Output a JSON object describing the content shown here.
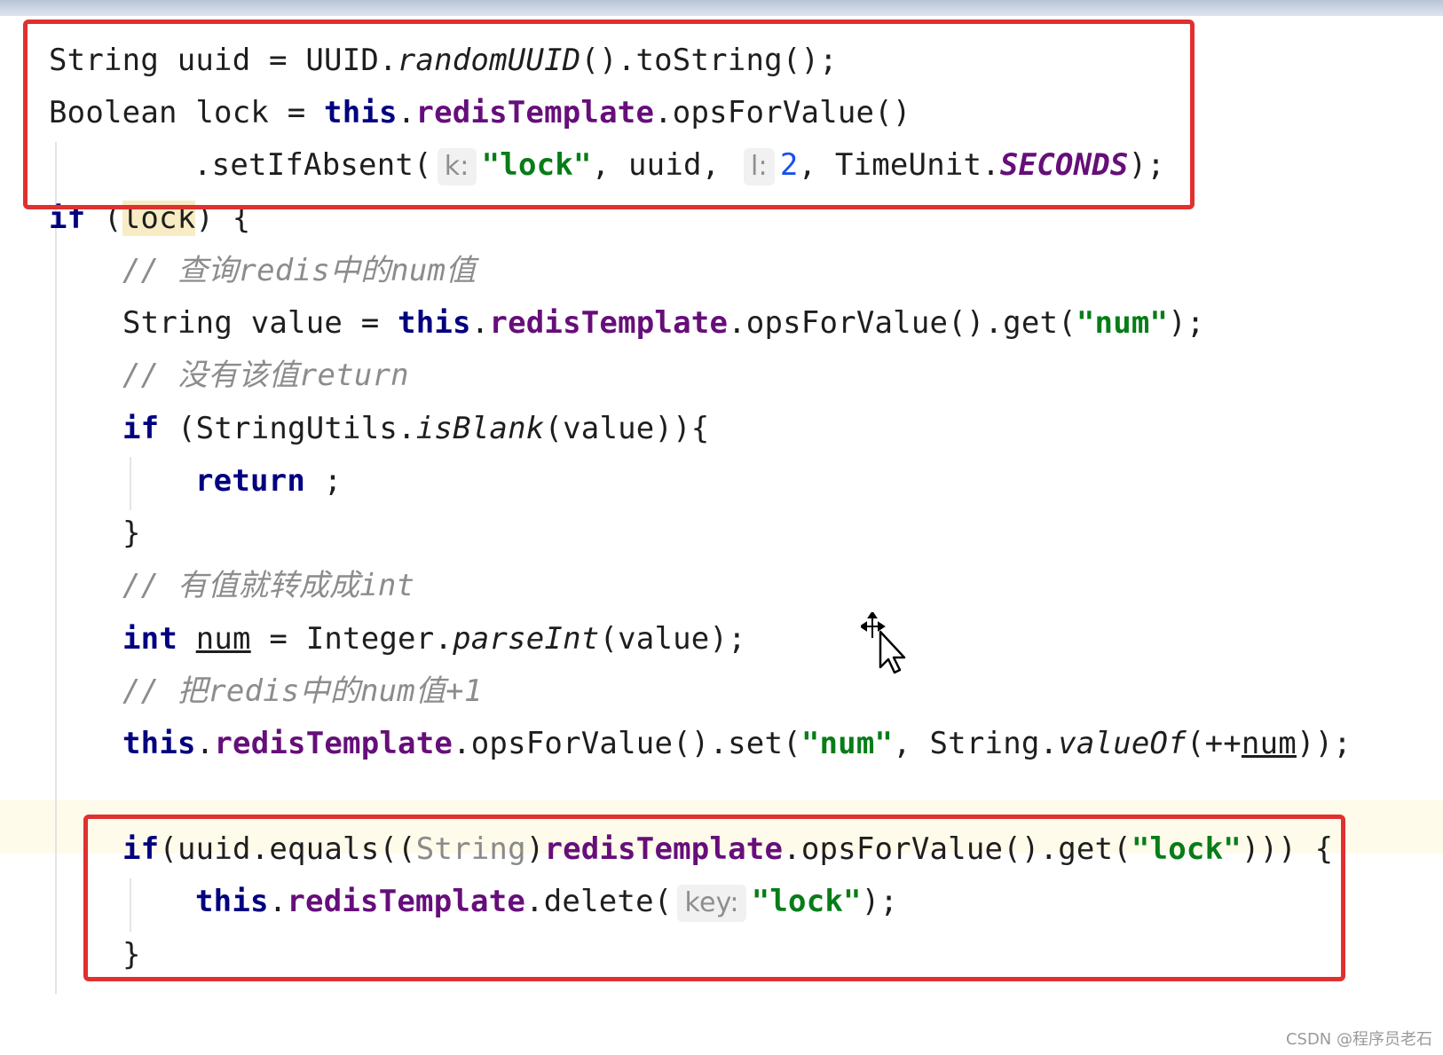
{
  "code": {
    "l1": {
      "a": "String uuid = UUID.",
      "b": "randomUUID",
      "c": "().toString();"
    },
    "l2": {
      "a": "Boolean lock = ",
      "this": "this",
      "dot": ".",
      "field": "redisTemplate",
      "c": ".opsForValue()"
    },
    "l3": {
      "a": ".setIfAbsent(",
      "hint_k": "k:",
      "str": "\"lock\"",
      "b": ", uuid, ",
      "hint_l": "l:",
      "num": "2",
      "c": ", TimeUnit.",
      "const": "SECONDS",
      "d": ");"
    },
    "l4": {
      "kw": "if",
      "a": " (",
      "lock": "lock",
      "b": ") {"
    },
    "l5": {
      "comment": "// 查询redis中的num值"
    },
    "l6": {
      "a": "String value = ",
      "this": "this",
      "dot": ".",
      "field": "redisTemplate",
      "b": ".opsForValue().get(",
      "str": "\"num\"",
      "c": ");"
    },
    "l7": {
      "comment": "// 没有该值return"
    },
    "l8": {
      "kw": "if",
      "a": " (StringUtils.",
      "ital": "isBlank",
      "b": "(value)){"
    },
    "l9": {
      "kw": "return",
      "a": " ;"
    },
    "l10": {
      "a": "}"
    },
    "l11": {
      "comment": "// 有值就转成成int"
    },
    "l12": {
      "kw": "int",
      "sp": " ",
      "var": "num",
      "a": " = Integer.",
      "ital": "parseInt",
      "b": "(value);"
    },
    "l13": {
      "comment": "// 把redis中的num值+1"
    },
    "l14": {
      "this": "this",
      "dot": ".",
      "field": "redisTemplate",
      "a": ".opsForValue().set(",
      "str": "\"num\"",
      "b": ", String.",
      "ital": "valueOf",
      "c": "(++",
      "var": "num",
      "d": "));"
    },
    "l15": {
      "kw": "if",
      "a": "(uuid.equals((",
      "muted": "String",
      "b": ")",
      "field": "redisTemplate",
      "c": ".opsForValue().get(",
      "str": "\"lock\"",
      "d": "))) {"
    },
    "l16": {
      "this": "this",
      "dot": ".",
      "field": "redisTemplate",
      "a": ".delete(",
      "hint_key": "key:",
      "str": "\"lock\"",
      "b": ");"
    },
    "l17": {
      "a": "}"
    }
  },
  "watermark": "CSDN @程序员老石"
}
